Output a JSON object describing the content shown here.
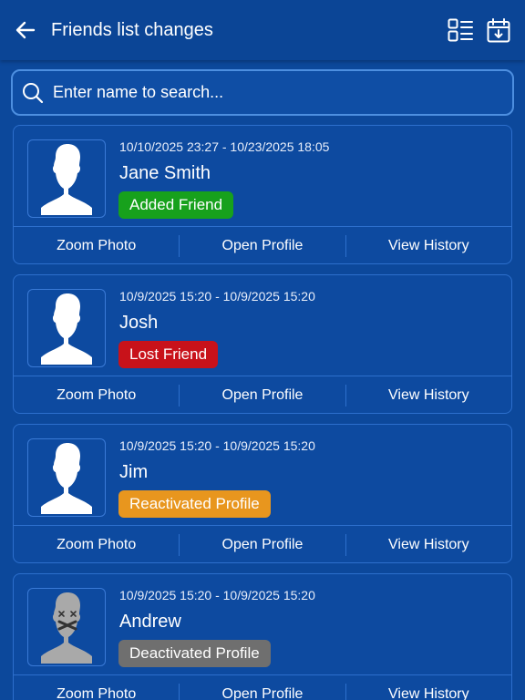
{
  "header": {
    "title": "Friends list changes",
    "back_icon": "arrow-left-icon",
    "layout_icon": "grid-list-icon",
    "calendar_icon": "calendar-download-icon"
  },
  "search": {
    "placeholder": "Enter name to search...",
    "value": ""
  },
  "actions": {
    "zoom": "Zoom Photo",
    "open": "Open Profile",
    "history": "View History"
  },
  "colors": {
    "background": "#0c489b",
    "added": "#17a11c",
    "lost": "#c8121a",
    "reactivated": "#e8961e",
    "deactivated": "#6f6f6f"
  },
  "items": [
    {
      "date": "10/10/2025 23:27 - 10/23/2025 18:05",
      "name": "Jane Smith",
      "status": "Added Friend",
      "status_color": "#17a11c",
      "avatar": "default-avatar-icon"
    },
    {
      "date": "10/9/2025 15:20 - 10/9/2025 15:20",
      "name": "Josh",
      "status": "Lost Friend",
      "status_color": "#c8121a",
      "avatar": "default-avatar-icon"
    },
    {
      "date": "10/9/2025 15:20 - 10/9/2025 15:20",
      "name": "Jim",
      "status": "Reactivated Profile",
      "status_color": "#e8961e",
      "avatar": "default-avatar-icon"
    },
    {
      "date": "10/9/2025 15:20 - 10/9/2025 15:20",
      "name": "Andrew",
      "status": "Deactivated Profile",
      "status_color": "#6f6f6f",
      "avatar": "deactivated-avatar-icon"
    }
  ]
}
